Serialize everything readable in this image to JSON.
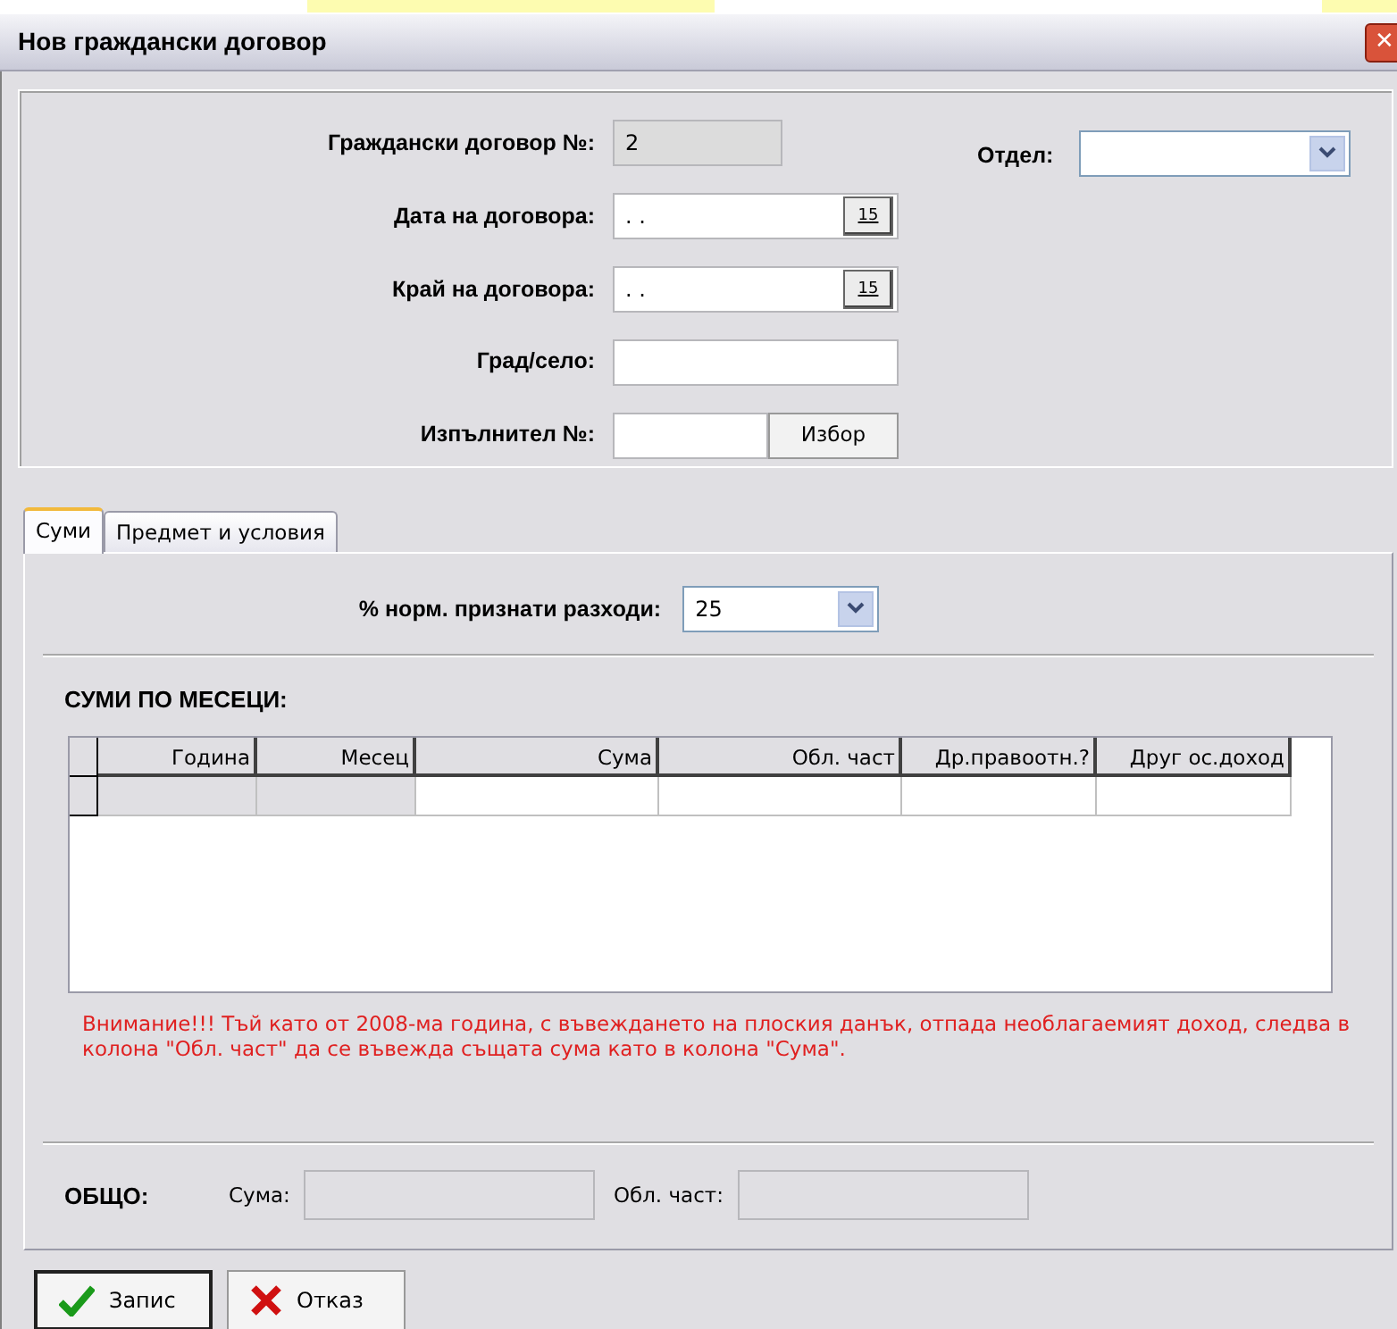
{
  "window": {
    "title": "Нов граждански договор",
    "close": "✕"
  },
  "form": {
    "fields": [
      {
        "kind": "readonly",
        "label": "Граждански договор №:",
        "value": "2"
      },
      {
        "kind": "date",
        "label": "Дата на договора:",
        "value": ". .",
        "button": "15"
      },
      {
        "kind": "date",
        "label": "Край на договора:",
        "value": ". .",
        "button": "15"
      },
      {
        "kind": "text",
        "label": "Град/село:"
      },
      {
        "kind": "picker",
        "label": "Изпълнител №:",
        "button": "Избор"
      }
    ],
    "department": {
      "label": "Отдел:"
    }
  },
  "tabs": [
    {
      "label": "Суми",
      "selected": true
    },
    {
      "label": "Предмет и условия",
      "selected": false
    }
  ],
  "expenses": {
    "label": "% норм. признати разходи:",
    "value": "25"
  },
  "grid": {
    "heading": "СУМИ ПО МЕСЕЦИ:",
    "columns": [
      {
        "label": "Година",
        "readonly": true
      },
      {
        "label": "Месец",
        "readonly": true
      },
      {
        "label": "Сума",
        "readonly": false
      },
      {
        "label": "Обл. част",
        "readonly": false
      },
      {
        "label": "Др.правоотн.?",
        "readonly": false
      },
      {
        "label": "Друг ос.доход",
        "readonly": false
      }
    ]
  },
  "warning": "Внимание!!!  Тъй като от 2008-ма година, с въвеждането на плоския данък, отпада необлагаемият доход, следва в колона \"Обл. част\" да се въвежда същата сума като в колона \"Сума\".",
  "totals": {
    "label": "ОБЩО:",
    "fields": [
      {
        "label": "Сума:"
      },
      {
        "label": "Обл. част:"
      }
    ]
  },
  "buttons": [
    {
      "kind": "ok",
      "label": "Запис",
      "default": true
    },
    {
      "kind": "cancel",
      "label": "Отказ",
      "default": false
    }
  ]
}
